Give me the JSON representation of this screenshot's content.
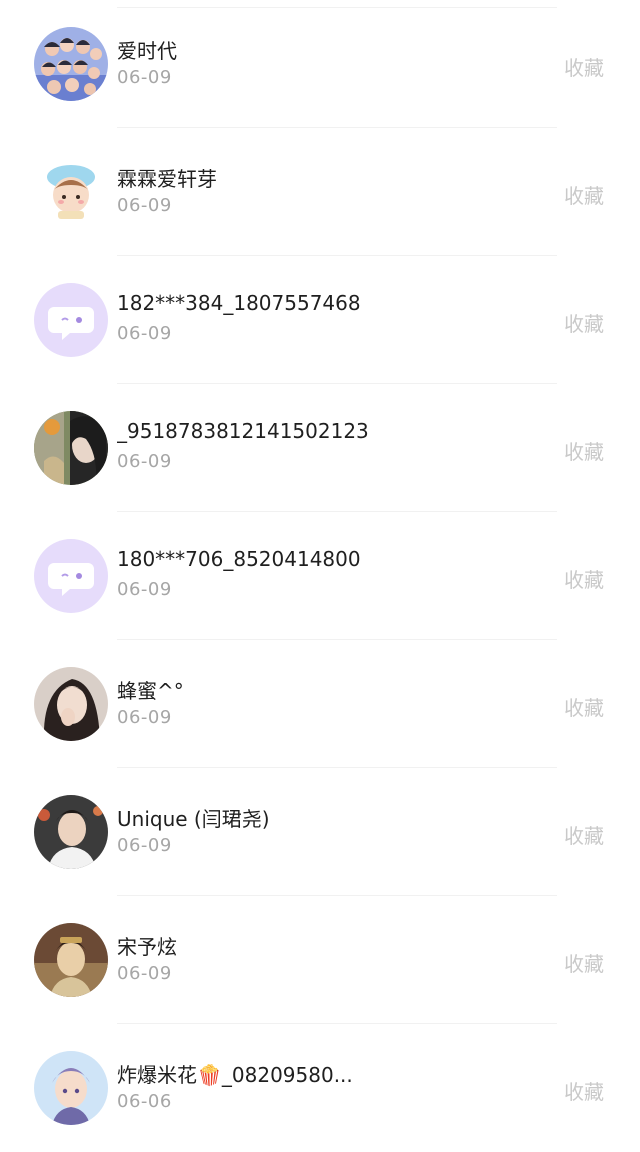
{
  "items": [
    {
      "name": "爱时代",
      "date": "06-09",
      "action": "收藏",
      "avatar": "group-photo-avatar"
    },
    {
      "name": "霖霖爱轩芽",
      "date": "06-09",
      "action": "收藏",
      "avatar": "cartoon-avatar"
    },
    {
      "name": "182***384_1807557468",
      "date": "06-09",
      "action": "收藏",
      "avatar": "default-chat-avatar"
    },
    {
      "name": "_9518783812141502123",
      "date": "06-09",
      "action": "收藏",
      "avatar": "photo-avatar"
    },
    {
      "name": "180***706_8520414800",
      "date": "06-09",
      "action": "收藏",
      "avatar": "default-chat-avatar"
    },
    {
      "name": "蜂蜜^°",
      "date": "06-09",
      "action": "收藏",
      "avatar": "photo-avatar"
    },
    {
      "name": "Unique (闫珺尧)",
      "date": "06-09",
      "action": "收藏",
      "avatar": "photo-avatar"
    },
    {
      "name": "宋予炫",
      "date": "06-09",
      "action": "收藏",
      "avatar": "portrait-avatar"
    },
    {
      "name": "炸爆米花🍿_08209580...",
      "date": "06-06",
      "action": "收藏",
      "avatar": "cartoon-avatar"
    }
  ],
  "colors": {
    "name": "#1f1f1f",
    "date": "#a6a6a6",
    "action": "#c9c9c9",
    "divider": "#f1f1f1",
    "default_avatar_bg": "#e6dcfb",
    "default_avatar_icon": "#b39ce8"
  }
}
